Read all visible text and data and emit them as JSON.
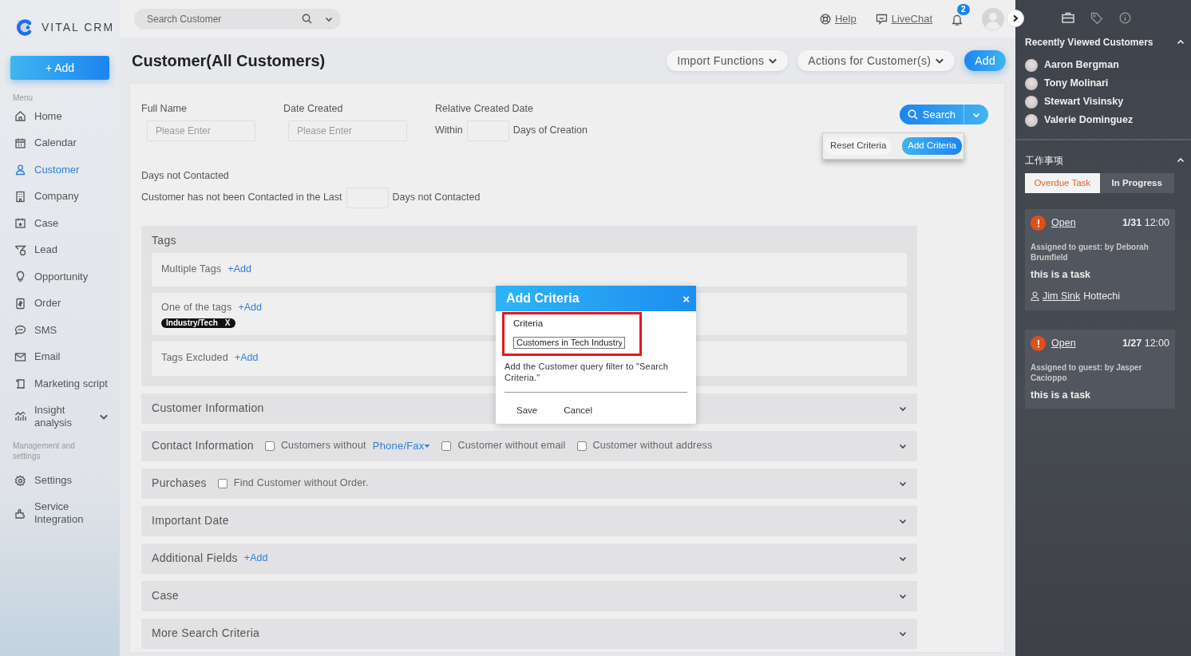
{
  "brand": {
    "name": "VITAL CRM"
  },
  "sidebar": {
    "add_button": "+ Add",
    "menu_label": "Menu",
    "items": [
      {
        "label": "Home",
        "selected": false
      },
      {
        "label": "Calendar",
        "selected": false
      },
      {
        "label": "Customer",
        "selected": true
      },
      {
        "label": "Company",
        "selected": false
      },
      {
        "label": "Case",
        "selected": false
      },
      {
        "label": "Lead",
        "selected": false
      },
      {
        "label": "Opportunity",
        "selected": false
      },
      {
        "label": "Order",
        "selected": false
      },
      {
        "label": "SMS",
        "selected": false
      },
      {
        "label": "Email",
        "selected": false
      },
      {
        "label": "Marketing script",
        "selected": false
      },
      {
        "label": "Insight analysis",
        "selected": false,
        "expanded": false
      }
    ],
    "settings_label": "Management and settings",
    "settings_items": [
      {
        "label": "Settings",
        "selected": false
      },
      {
        "label": "Service Integration",
        "selected": false
      }
    ]
  },
  "topbar": {
    "search": {
      "placeholder": "Search Customer"
    },
    "help": "Help",
    "livechat": "LiveChat",
    "notifications": "2"
  },
  "page": {
    "title": "Customer(All Customers)",
    "buttons": [
      {
        "label": "Import Functions",
        "kind": "dropdown"
      },
      {
        "label": "Actions for Customer(s)",
        "kind": "dropdown"
      },
      {
        "label": "Add",
        "kind": "primary"
      }
    ]
  },
  "filters": {
    "full_name": {
      "label": "Full Name",
      "placeholder": "Please Enter"
    },
    "date_created": {
      "label": "Date Created",
      "placeholder": "Please Enter"
    },
    "relative": {
      "label": "Relative Created Date",
      "prefix": "Within",
      "suffix": "Days of Creation"
    },
    "not_contacted": {
      "label": "Days not Contacted",
      "prefix": "Customer has not been Contacted in the Last",
      "suffix": "Days not Contacted"
    },
    "search_button": "Search",
    "search_menu": [
      {
        "label": "Reset Criteria",
        "kind": "plain"
      },
      {
        "label": "Add Criteria",
        "kind": "primary"
      }
    ]
  },
  "tags": {
    "title": "Tags",
    "rows": [
      {
        "label": "Multiple Tags",
        "add": "+Add",
        "tags": []
      },
      {
        "label": "One of the tags",
        "add": "+Add",
        "tags": [
          {
            "label": "Industry/Tech",
            "remove": "X"
          }
        ]
      },
      {
        "label": "Tags Excluded",
        "add": "+Add",
        "tags": []
      }
    ]
  },
  "sections": [
    {
      "title": "Customer Information",
      "kind": "plain",
      "expanded": false
    },
    {
      "title": "Contact Information",
      "kind": "checkboxes",
      "expanded": false,
      "options": [
        {
          "label": "Customers without",
          "link": "Phone/Fax",
          "checked": false
        },
        {
          "label": "Customer without email",
          "checked": false
        },
        {
          "label": "Customer without address",
          "checked": false
        }
      ]
    },
    {
      "title": "Purchases",
      "kind": "checkboxes",
      "expanded": false,
      "options": [
        {
          "label": "Find Customer without Order.",
          "checked": false
        }
      ]
    },
    {
      "title": "Important Date",
      "kind": "plain",
      "expanded": false
    },
    {
      "title": "Additional Fields",
      "kind": "add",
      "add": "+Add",
      "expanded": false
    },
    {
      "title": "Case",
      "kind": "plain",
      "expanded": false
    },
    {
      "title": "More Search Criteria",
      "kind": "plain",
      "expanded": false
    }
  ],
  "modal": {
    "title": "Add Criteria",
    "close": "×",
    "field_label": "Criteria",
    "value": "Customers in Tech Industry",
    "highlighted": true,
    "help": "Add the Customer query filter to \"Search Criteria.\"",
    "buttons": [
      "Save",
      "Cancel"
    ]
  },
  "right_panel": {
    "recent": {
      "title": "Recently Viewed Customers",
      "expanded": true,
      "customers": [
        "Aaron Bergman",
        "Tony Molinari",
        "Stewart Visinsky",
        "Valerie Dominguez"
      ]
    },
    "work": {
      "title": "工作事项",
      "expanded": true,
      "tabs": [
        {
          "label": "Overdue Task",
          "selected": true
        },
        {
          "label": "In Progress",
          "selected": false
        }
      ],
      "tasks": [
        {
          "status": "Open",
          "date": "1/31",
          "time": "12:00",
          "assigned": "Assigned to guest: by Deborah Brumfield",
          "text": "this is a task",
          "contact_link": "Jim Sink",
          "contact_rest": "Hottechi"
        },
        {
          "status": "Open",
          "date": "1/27",
          "time": "12:00",
          "assigned": "Assigned to guest: by Jasper Cacioppo",
          "text": "this is a task"
        }
      ]
    }
  }
}
